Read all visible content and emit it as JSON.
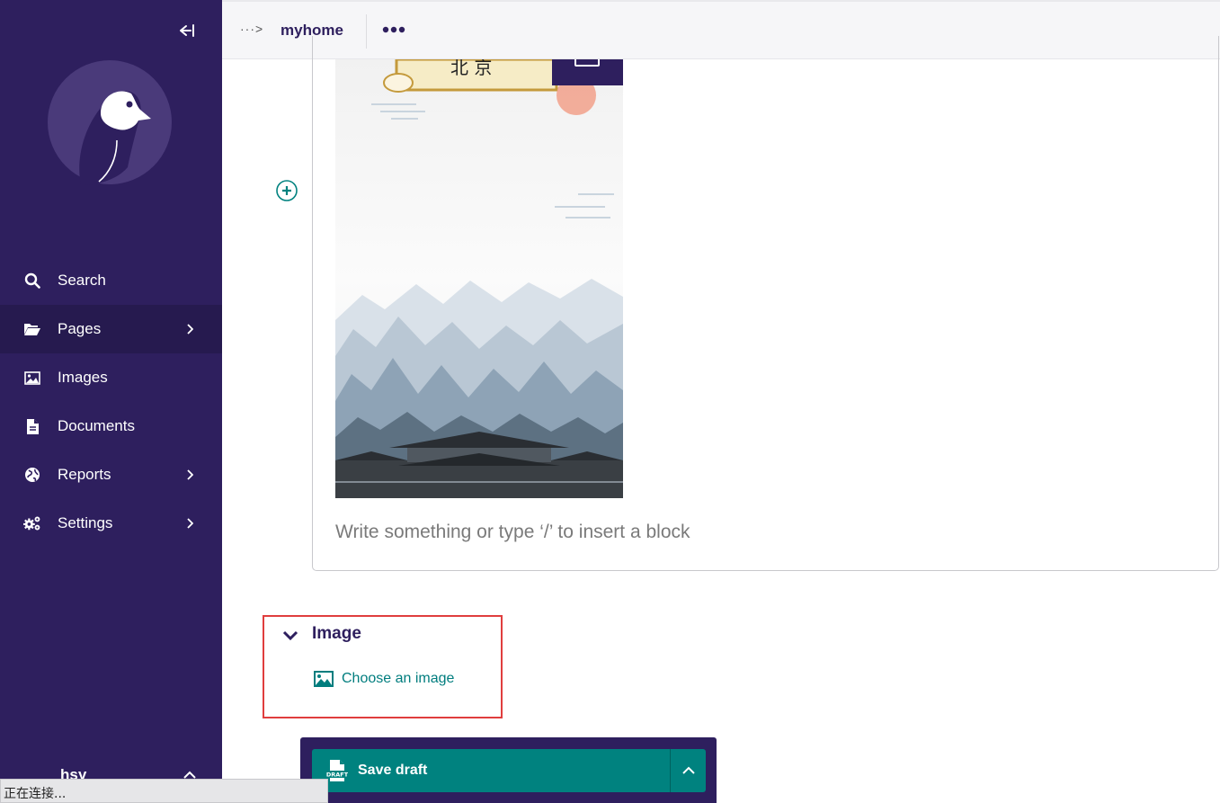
{
  "sidebar": {
    "items": [
      {
        "label": "Search",
        "icon": "search-icon",
        "has_submenu": false,
        "active": false
      },
      {
        "label": "Pages",
        "icon": "folder-open-icon",
        "has_submenu": true,
        "active": true
      },
      {
        "label": "Images",
        "icon": "image-icon",
        "has_submenu": false,
        "active": false
      },
      {
        "label": "Documents",
        "icon": "document-icon",
        "has_submenu": false,
        "active": false
      },
      {
        "label": "Reports",
        "icon": "globe-icon",
        "has_submenu": true,
        "active": false
      },
      {
        "label": "Settings",
        "icon": "cogs-icon",
        "has_submenu": true,
        "active": false
      }
    ],
    "user": {
      "name": "hsy"
    }
  },
  "header": {
    "breadcrumb_more": "···>",
    "title": "myhome"
  },
  "picture": {
    "caption_chars": "北 京"
  },
  "editor": {
    "placeholder": "Write something or type ‘/’ to insert a block"
  },
  "image_field": {
    "label": "Image",
    "choose_label": "Choose an image"
  },
  "actions": {
    "save_label": "Save draft",
    "save_icon_text": "DRAFT"
  },
  "status_bar": {
    "text": "正在连接..."
  },
  "colors": {
    "sidebar": "#2e1f5e",
    "accent": "#00827f",
    "link": "#007d7e",
    "highlight_border": "#e03e3e"
  }
}
